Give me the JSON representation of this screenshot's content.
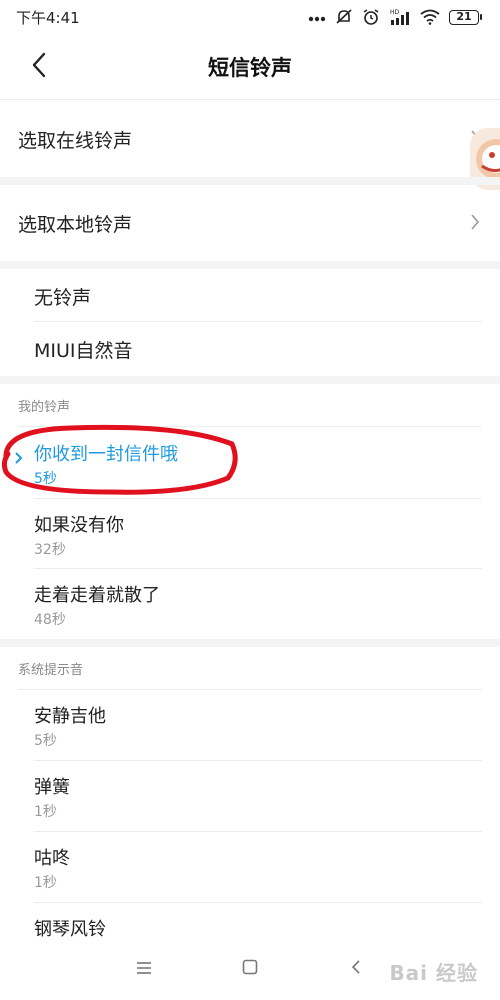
{
  "status_bar": {
    "time": "下午4:41",
    "battery": "21",
    "hd_label": "HD"
  },
  "header": {
    "title": "短信铃声"
  },
  "nav_rows": [
    {
      "label": "选取在线铃声"
    },
    {
      "label": "选取本地铃声"
    }
  ],
  "preset_rows": [
    {
      "label": "无铃声"
    },
    {
      "label": "MIUI自然音"
    }
  ],
  "my_ringtones": {
    "header": "我的铃声",
    "items": [
      {
        "title": "你收到一封信件哦",
        "duration": "5秒",
        "selected": true
      },
      {
        "title": "如果没有你",
        "duration": "32秒"
      },
      {
        "title": "走着走着就散了",
        "duration": "48秒"
      }
    ]
  },
  "system_sounds": {
    "header": "系统提示音",
    "items": [
      {
        "title": "安静吉他",
        "duration": "5秒"
      },
      {
        "title": "弹簧",
        "duration": "1秒"
      },
      {
        "title": "咕咚",
        "duration": "1秒"
      },
      {
        "title": "钢琴风铃",
        "duration": ""
      }
    ]
  },
  "watermark": {
    "text": "Bai 经验"
  },
  "colors": {
    "accent": "#1f9ae0",
    "annotation": "#e0101e",
    "gap": "#f4f4f4"
  },
  "icons": [
    "back-arrow-icon",
    "chevron-right-icon",
    "mute-icon",
    "alarm-icon",
    "signal-icon",
    "wifi-icon",
    "battery-icon",
    "menu-icon",
    "home-icon",
    "back-icon"
  ]
}
